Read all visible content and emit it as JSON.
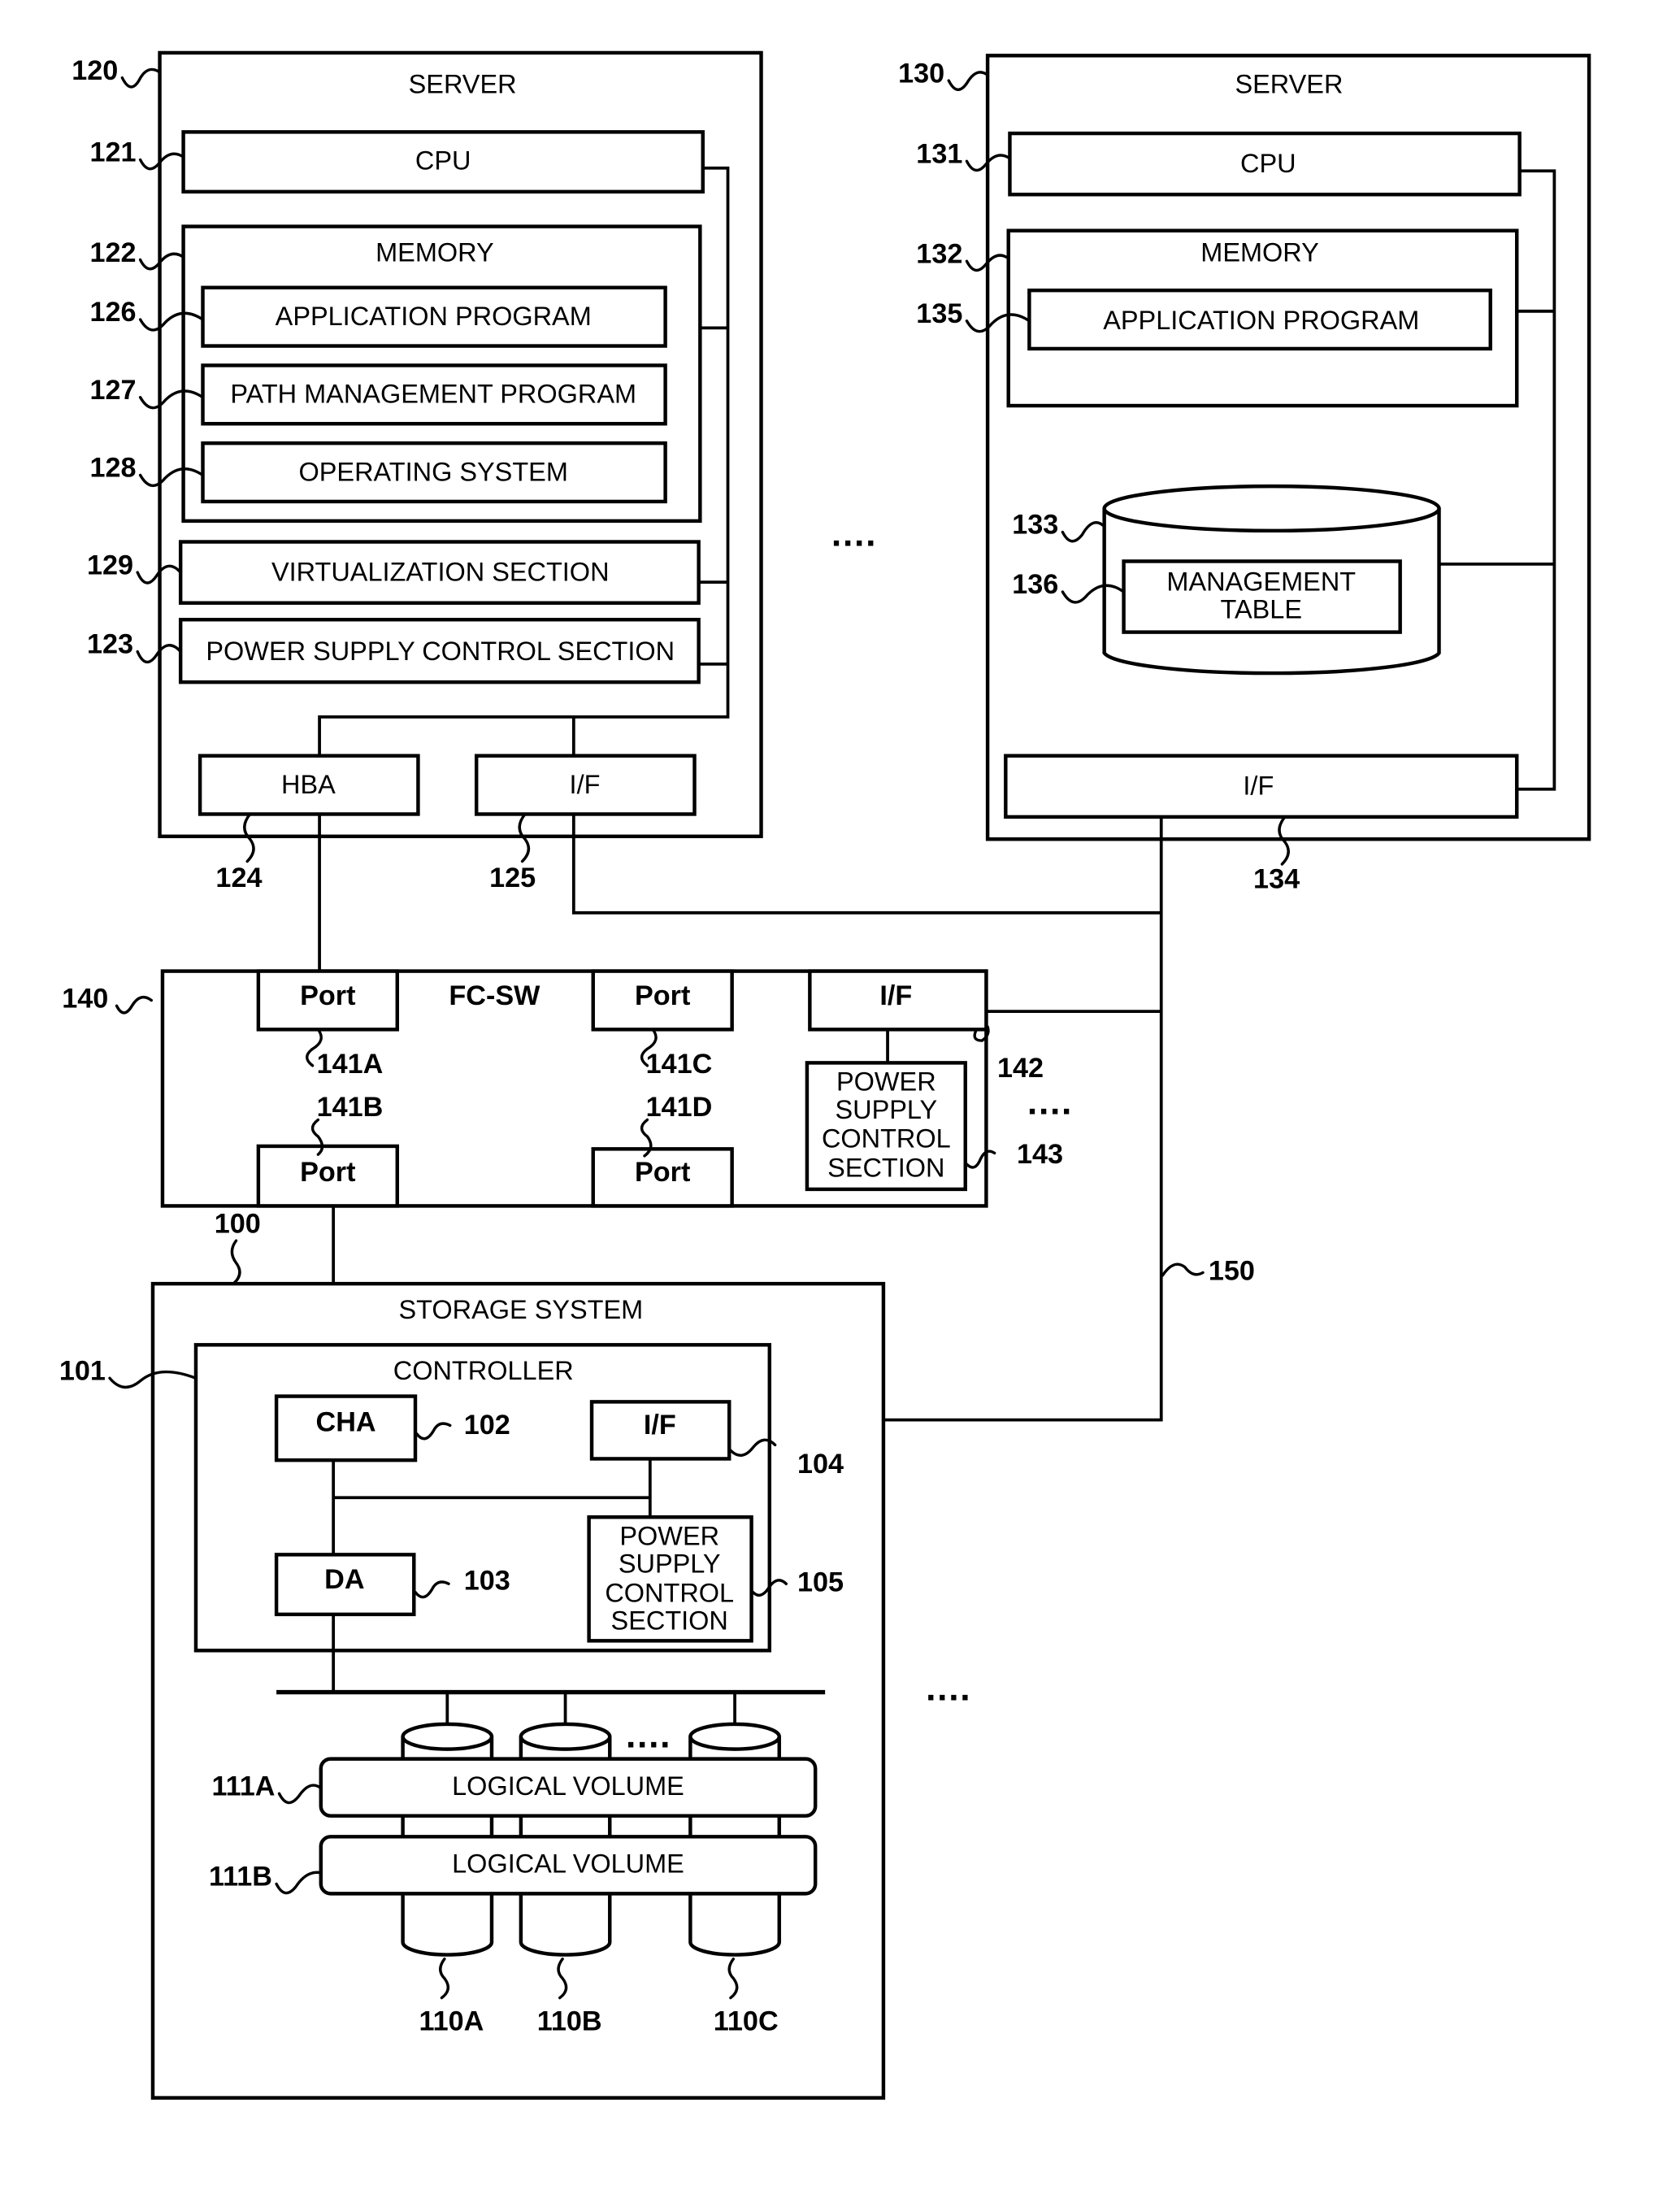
{
  "server_a": {
    "ref": "120",
    "title": "SERVER",
    "cpu": {
      "ref": "121",
      "label": "CPU"
    },
    "memory": {
      "ref": "122",
      "label": "MEMORY",
      "application_program": {
        "ref": "126",
        "label": "APPLICATION PROGRAM"
      },
      "path_management_program": {
        "ref": "127",
        "label": "PATH MANAGEMENT PROGRAM"
      },
      "operating_system": {
        "ref": "128",
        "label": "OPERATING SYSTEM"
      }
    },
    "virtualization_section": {
      "ref": "129",
      "label": "VIRTUALIZATION SECTION"
    },
    "power_supply_control_section": {
      "ref": "123",
      "label": "POWER SUPPLY CONTROL SECTION"
    },
    "hba": {
      "ref": "124",
      "label": "HBA"
    },
    "interface": {
      "ref": "125",
      "label": "I/F"
    }
  },
  "server_b": {
    "ref": "130",
    "title": "SERVER",
    "cpu": {
      "ref": "131",
      "label": "CPU"
    },
    "memory": {
      "ref": "132",
      "label": "MEMORY",
      "application_program": {
        "ref": "135",
        "label": "APPLICATION PROGRAM"
      }
    },
    "storage_device": {
      "ref": "133"
    },
    "management_table": {
      "ref": "136",
      "line1": "MANAGEMENT",
      "line2": "TABLE"
    },
    "interface": {
      "ref": "134",
      "label": "I/F"
    }
  },
  "fc_switch": {
    "ref": "140",
    "label": "FC-SW",
    "ports": [
      {
        "ref": "141A",
        "label": "Port"
      },
      {
        "ref": "141B",
        "label": "Port"
      },
      {
        "ref": "141C",
        "label": "Port"
      },
      {
        "ref": "141D",
        "label": "Port"
      }
    ],
    "interface": {
      "ref": "142",
      "label": "I/F"
    },
    "power_supply_control_section": {
      "ref": "143",
      "lines": [
        "POWER",
        "SUPPLY",
        "CONTROL",
        "SECTION"
      ]
    }
  },
  "network": {
    "ref": "150"
  },
  "storage_system": {
    "ref": "100",
    "title": "STORAGE SYSTEM",
    "controller": {
      "ref": "101",
      "label": "CONTROLLER",
      "cha": {
        "ref": "102",
        "label": "CHA"
      },
      "da": {
        "ref": "103",
        "label": "DA"
      },
      "interface": {
        "ref": "104",
        "label": "I/F"
      },
      "power_supply_control_section": {
        "ref": "105",
        "lines": [
          "POWER",
          "SUPPLY",
          "CONTROL",
          "SECTION"
        ]
      }
    },
    "logical_volumes": [
      {
        "ref": "111A",
        "label": "LOGICAL VOLUME"
      },
      {
        "ref": "111B",
        "label": "LOGICAL VOLUME"
      }
    ],
    "disks": [
      {
        "ref": "110A"
      },
      {
        "ref": "110B"
      },
      {
        "ref": "110C"
      }
    ]
  },
  "ellipsis": "...."
}
